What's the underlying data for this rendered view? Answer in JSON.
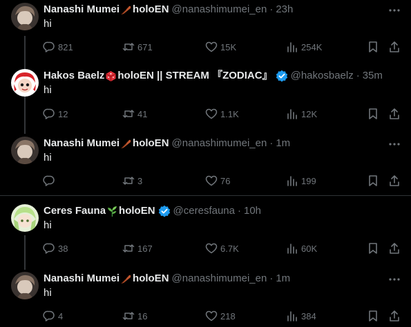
{
  "colors": {
    "background": "#000000",
    "text_primary": "#e7e9ea",
    "text_secondary": "#71767b",
    "divider": "#2f3336",
    "verified": "#1d9bf0"
  },
  "icons": {
    "reply": "speech-bubble-icon",
    "retweet": "retweet-arrows-icon",
    "like": "heart-icon",
    "views": "bar-chart-icon",
    "bookmark": "bookmark-icon",
    "share": "share-upload-icon",
    "more": "three-dots-icon"
  },
  "tweets": [
    {
      "name": "Nanashi Mumei",
      "name_emoji": "feather-emoji",
      "name_suffix": "holoEN",
      "handle": "@nanashimumei_en",
      "separator": "·",
      "time": "23h",
      "text": "hi",
      "replies": "821",
      "retweets": "671",
      "likes": "15K",
      "views": "254K"
    },
    {
      "name": "Hakos Baelz",
      "name_emoji": "die-emoji",
      "name_suffix": "holoEN || STREAM 『ZODIAC』",
      "verified": true,
      "handle": "@hakosbaelz",
      "separator": "·",
      "time": "35m",
      "text": "hi",
      "replies": "12",
      "retweets": "41",
      "likes": "1.1K",
      "views": "12K"
    },
    {
      "name": "Nanashi Mumei",
      "name_emoji": "feather-emoji",
      "name_suffix": "holoEN",
      "handle": "@nanashimumei_en",
      "separator": "·",
      "time": "1m",
      "text": "hi",
      "replies": "",
      "retweets": "3",
      "likes": "76",
      "views": "199"
    },
    {
      "name": "Ceres Fauna",
      "name_emoji": "plant-emoji",
      "name_suffix": "holoEN",
      "verified": true,
      "handle": "@ceresfauna",
      "separator": "·",
      "time": "10h",
      "text": "hi",
      "replies": "38",
      "retweets": "167",
      "likes": "6.7K",
      "views": "60K"
    },
    {
      "name": "Nanashi Mumei",
      "name_emoji": "feather-emoji",
      "name_suffix": "holoEN",
      "handle": "@nanashimumei_en",
      "separator": "·",
      "time": "1m",
      "text": "hi",
      "replies": "4",
      "retweets": "16",
      "likes": "218",
      "views": "384"
    }
  ]
}
